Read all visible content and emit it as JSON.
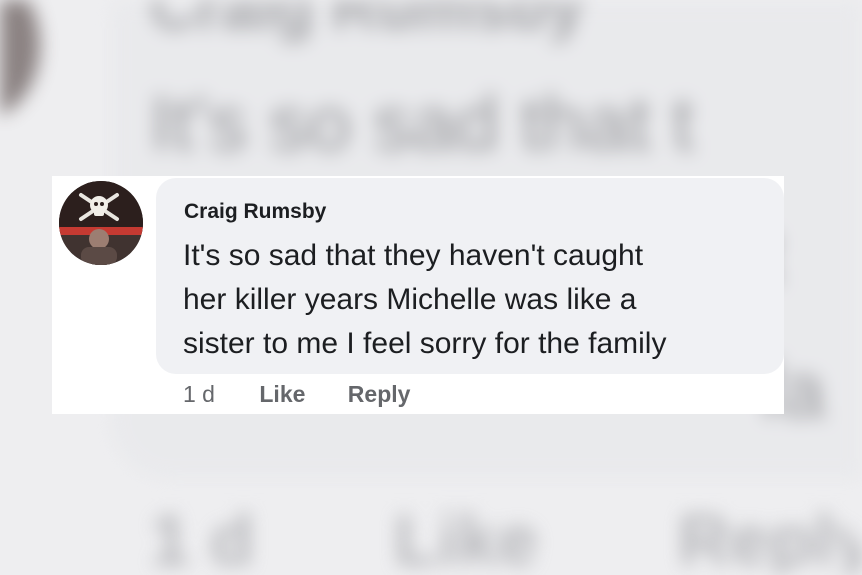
{
  "comment": {
    "author": "Craig Rumsby",
    "text_lines": [
      "It's so sad that they haven't caught",
      "her killer years Michelle was like a",
      "sister to me I feel sorry for the family"
    ],
    "timestamp": "1 d",
    "like_label": "Like",
    "reply_label": "Reply"
  },
  "background": {
    "name_fragment": "Craig Rumsby",
    "text_fragment": "It's so sad that t",
    "line2_fragment": "t",
    "line3_fragment": "fa",
    "timestamp": "1 d",
    "like_label": "Like",
    "reply_label": "Reply"
  },
  "colors": {
    "bubble": "#f0f1f4",
    "text": "#1c1e21",
    "secondary": "#65676b",
    "background": "#eeeef0"
  },
  "icons": {
    "avatar": "skull-crossbones-avatar"
  }
}
